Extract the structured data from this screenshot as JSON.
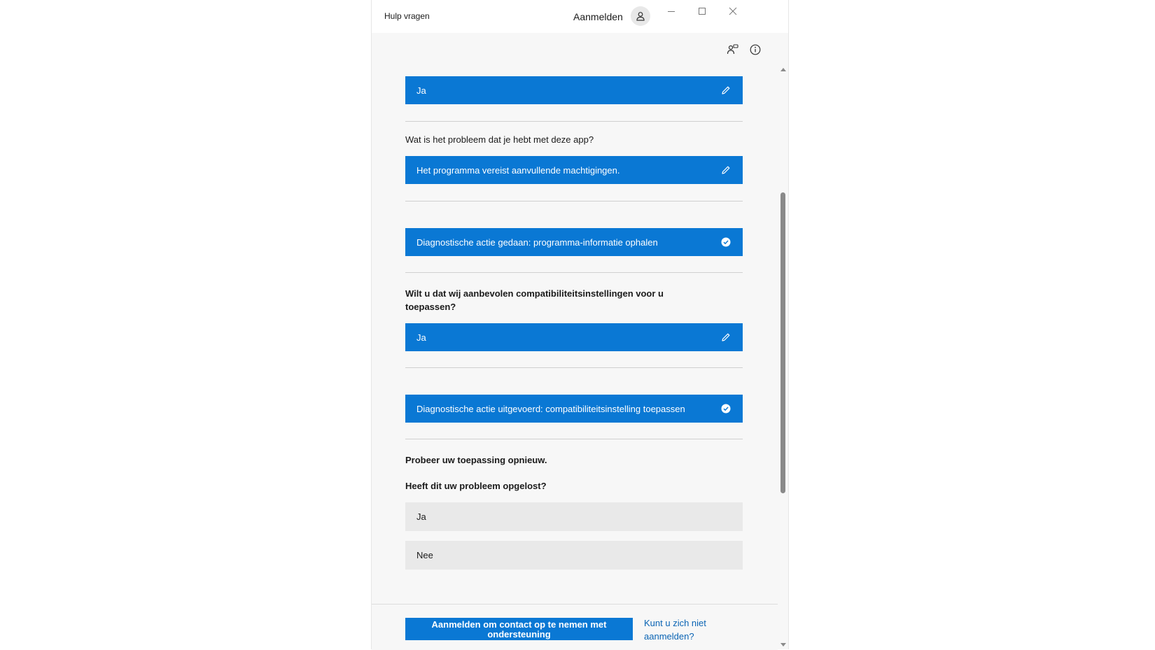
{
  "window": {
    "title": "Hulp vragen",
    "signin_label": "Aanmelden"
  },
  "conversation": {
    "answer_1": "Ja",
    "question_problem": "Wat is het probleem dat je hebt met deze app?",
    "answer_problem": "Het programma vereist aanvullende machtigingen.",
    "diag_action_1": "Diagnostische actie gedaan: programma-informatie ophalen",
    "question_compat": "Wilt u dat wij aanbevolen compatibiliteitsinstellingen voor u toepassen?",
    "answer_compat": "Ja",
    "diag_action_2": "Diagnostische actie uitgevoerd: compatibiliteitsinstelling toepassen",
    "retry_text": "Probeer uw toepassing opnieuw.",
    "question_solved": "Heeft dit uw probleem opgelost?",
    "option_yes": "Ja",
    "option_no": "Nee"
  },
  "footer": {
    "contact_button": "Aanmelden om contact op te nemen met ondersteuning",
    "cant_signin_link": "Kunt u zich niet aanmelden?"
  },
  "icons": [
    "person-icon",
    "minimize-icon",
    "maximize-icon",
    "close-icon",
    "share-icon",
    "info-icon",
    "edit-icon",
    "checkmark-icon",
    "scroll-up-icon",
    "scroll-down-icon"
  ],
  "colors": {
    "accent": "#0a78d4",
    "link": "#0a64b4",
    "background": "#f7f7f7"
  }
}
